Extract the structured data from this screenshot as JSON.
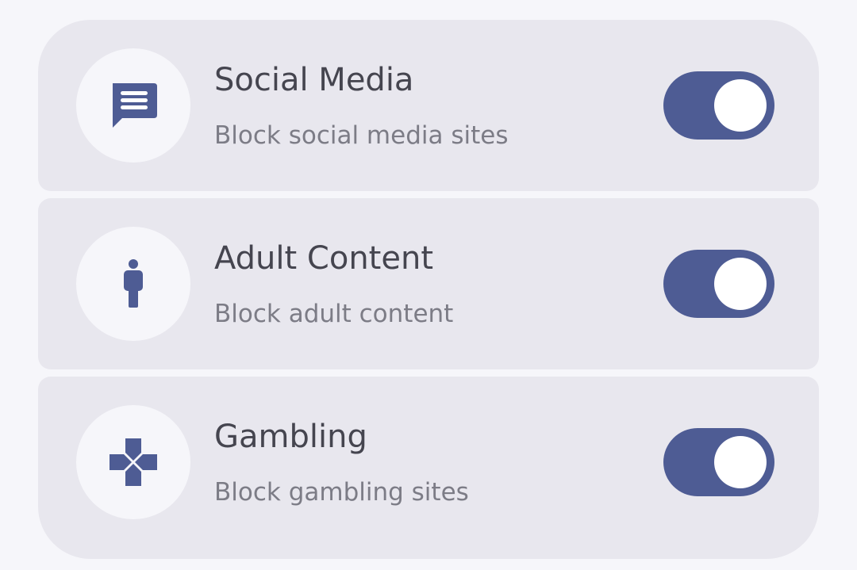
{
  "colors": {
    "page_background": "#f6f6fa",
    "card_background": "#e8e7ee",
    "accent": "#4e5c94",
    "title_text": "#45454f",
    "subtitle_text": "#7c7c86"
  },
  "filters": [
    {
      "title": "Social Media",
      "subtitle": "Block social media sites",
      "icon": "chat-message-icon",
      "enabled": true
    },
    {
      "title": "Adult Content",
      "subtitle": "Block adult content",
      "icon": "person-icon",
      "enabled": true
    },
    {
      "title": "Gambling",
      "subtitle": "Block gambling sites",
      "icon": "gamepad-icon",
      "enabled": true
    }
  ]
}
